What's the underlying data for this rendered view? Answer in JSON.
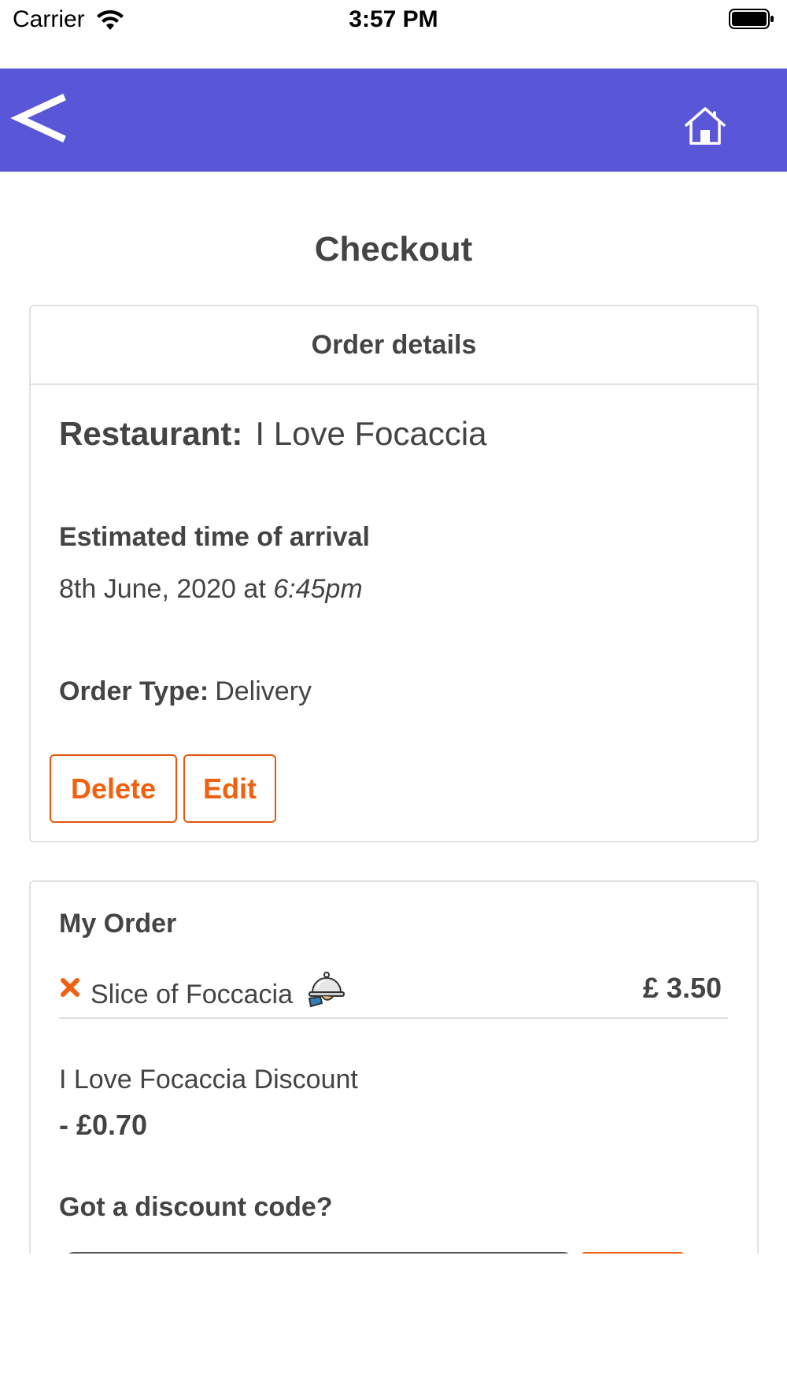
{
  "status_bar": {
    "carrier": "Carrier",
    "time": "3:57 PM"
  },
  "nav": {
    "back_icon": "chevron-left-icon",
    "home_icon": "home-icon",
    "background_color": "#5957d7"
  },
  "page": {
    "title": "Checkout"
  },
  "order_details": {
    "header": "Order details",
    "restaurant_label": "Restaurant:",
    "restaurant_name": "I Love Focaccia",
    "eta_label": "Estimated time of arrival",
    "eta_date": "8th June, 2020 at",
    "eta_time": "6:45pm",
    "order_type_label": "Order Type:",
    "order_type_value": "Delivery",
    "delete_label": "Delete",
    "edit_label": "Edit",
    "accent_color": "#f0600f"
  },
  "my_order": {
    "title": "My Order",
    "items": [
      {
        "name": "Slice of Foccacia",
        "price": "£ 3.50",
        "remove_icon": "close-icon",
        "type_icon": "serving-cloche-icon"
      }
    ],
    "discount_name": "I Love Focaccia Discount",
    "discount_amount": "- £0.70",
    "discount_code_question": "Got a discount code?"
  }
}
